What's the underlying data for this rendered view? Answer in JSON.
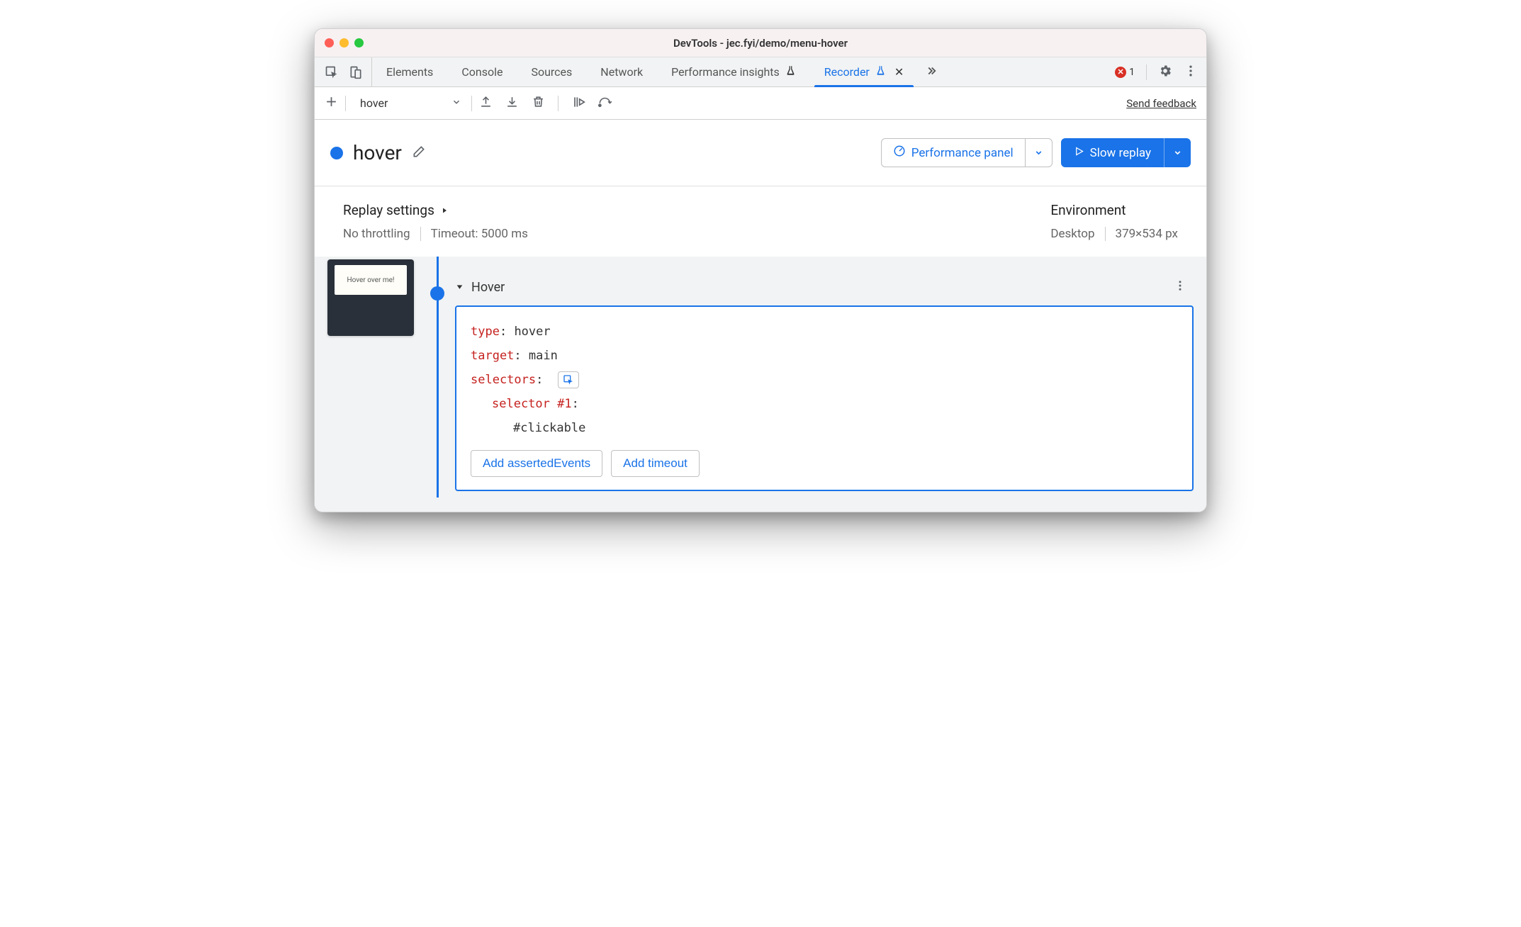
{
  "window": {
    "title": "DevTools - jec.fyi/demo/menu-hover"
  },
  "tabs": {
    "items": [
      "Elements",
      "Console",
      "Sources",
      "Network",
      "Performance insights",
      "Recorder"
    ],
    "active": "Recorder"
  },
  "errors": {
    "count": "1"
  },
  "toolbar": {
    "recording_name": "hover",
    "send_feedback": "Send feedback"
  },
  "header": {
    "recording_title": "hover",
    "perf_panel_label": "Performance panel",
    "replay_label": "Slow replay"
  },
  "settings": {
    "replay_title": "Replay settings",
    "throttling": "No throttling",
    "timeout": "Timeout: 5000 ms",
    "env_title": "Environment",
    "device": "Desktop",
    "dimensions": "379×534 px"
  },
  "thumbnail": {
    "label": "Hover over me!"
  },
  "step": {
    "title": "Hover",
    "type_key": "type",
    "type_val": "hover",
    "target_key": "target",
    "target_val": "main",
    "selectors_key": "selectors",
    "selector1_key": "selector #1",
    "selector1_val": "#clickable",
    "add_asserted": "Add assertedEvents",
    "add_timeout": "Add timeout"
  }
}
